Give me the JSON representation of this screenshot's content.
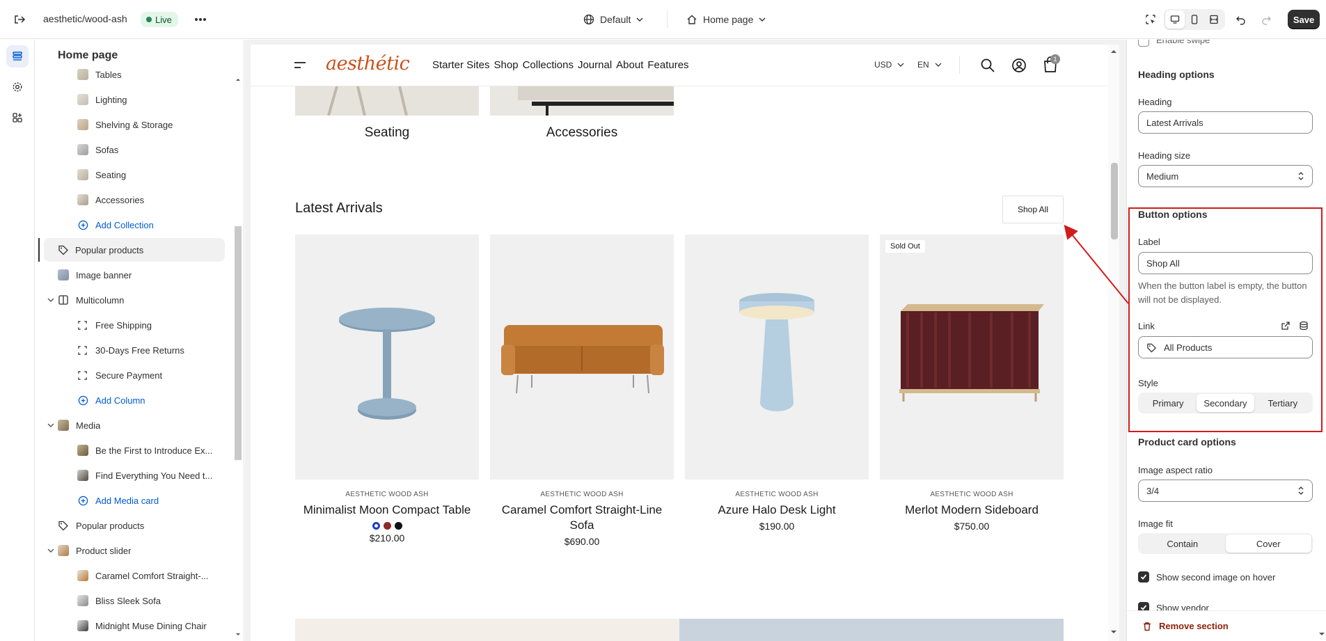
{
  "topbar": {
    "store_name": "aesthetic/wood-ash",
    "status_badge": "Live",
    "theme_selector": "Default",
    "page_selector": "Home page",
    "save_label": "Save"
  },
  "sidebar": {
    "title": "Home page",
    "items": [
      {
        "label": "Tables"
      },
      {
        "label": "Lighting"
      },
      {
        "label": "Shelving & Storage"
      },
      {
        "label": "Sofas"
      },
      {
        "label": "Seating"
      },
      {
        "label": "Accessories"
      },
      {
        "label": "Add Collection"
      },
      {
        "label": "Popular products"
      },
      {
        "label": "Image banner"
      },
      {
        "label": "Multicolumn"
      },
      {
        "label": "Free Shipping"
      },
      {
        "label": "30-Days Free Returns"
      },
      {
        "label": "Secure Payment"
      },
      {
        "label": "Add Column"
      },
      {
        "label": "Media"
      },
      {
        "label": "Be the First to Introduce Ex..."
      },
      {
        "label": "Find Everything You Need t..."
      },
      {
        "label": "Add Media card"
      },
      {
        "label": "Popular products"
      },
      {
        "label": "Product slider"
      },
      {
        "label": "Caramel Comfort Straight-..."
      },
      {
        "label": "Bliss Sleek Sofa"
      },
      {
        "label": "Midnight Muse Dining Chair"
      }
    ]
  },
  "storefront": {
    "logo": "aesthétic",
    "nav": [
      "Starter Sites",
      "Shop",
      "Collections",
      "Journal",
      "About",
      "Features"
    ],
    "currency": "USD",
    "language": "EN",
    "cart_count": "1",
    "collections": [
      "Seating",
      "Accessories"
    ],
    "section_title": "Latest Arrivals",
    "shop_all": "Shop All",
    "sold_out": "Sold Out",
    "products": [
      {
        "vendor": "AESTHETIC WOOD ASH",
        "name": "Minimalist Moon Compact Table",
        "price": "$210.00"
      },
      {
        "vendor": "AESTHETIC WOOD ASH",
        "name": "Caramel Comfort Straight-Line Sofa",
        "price": "$690.00"
      },
      {
        "vendor": "AESTHETIC WOOD ASH",
        "name": "Azure Halo Desk Light",
        "price": "$190.00"
      },
      {
        "vendor": "AESTHETIC WOOD ASH",
        "name": "Merlot Modern Sideboard",
        "price": "$750.00"
      }
    ],
    "swatch_colors": [
      "#1f3fbf",
      "#8b2a2a",
      "#111111"
    ]
  },
  "settings": {
    "enable_swipe": "Enable swipe",
    "heading_options": {
      "title": "Heading options",
      "heading_label": "Heading",
      "heading_value": "Latest Arrivals",
      "size_label": "Heading size",
      "size_value": "Medium"
    },
    "button_options": {
      "title": "Button options",
      "label_label": "Label",
      "label_value": "Shop All",
      "help": "When the button label is empty, the button will not be displayed.",
      "link_label": "Link",
      "link_value": "All Products",
      "style_label": "Style",
      "styles": [
        "Primary",
        "Secondary",
        "Tertiary"
      ],
      "selected_style": "Secondary"
    },
    "product_card_options": {
      "title": "Product card options",
      "aspect_label": "Image aspect ratio",
      "aspect_value": "3/4",
      "fit_label": "Image fit",
      "fit_options": [
        "Contain",
        "Cover"
      ],
      "selected_fit": "Cover",
      "show_second_image": "Show second image on hover",
      "show_vendor": "Show vendor"
    },
    "remove_section": "Remove section"
  },
  "colors": {
    "accent_blue": "#005bd3",
    "logo_orange": "#c8511c",
    "highlight_red": "#d21b1b",
    "live_green": "#29845a"
  }
}
